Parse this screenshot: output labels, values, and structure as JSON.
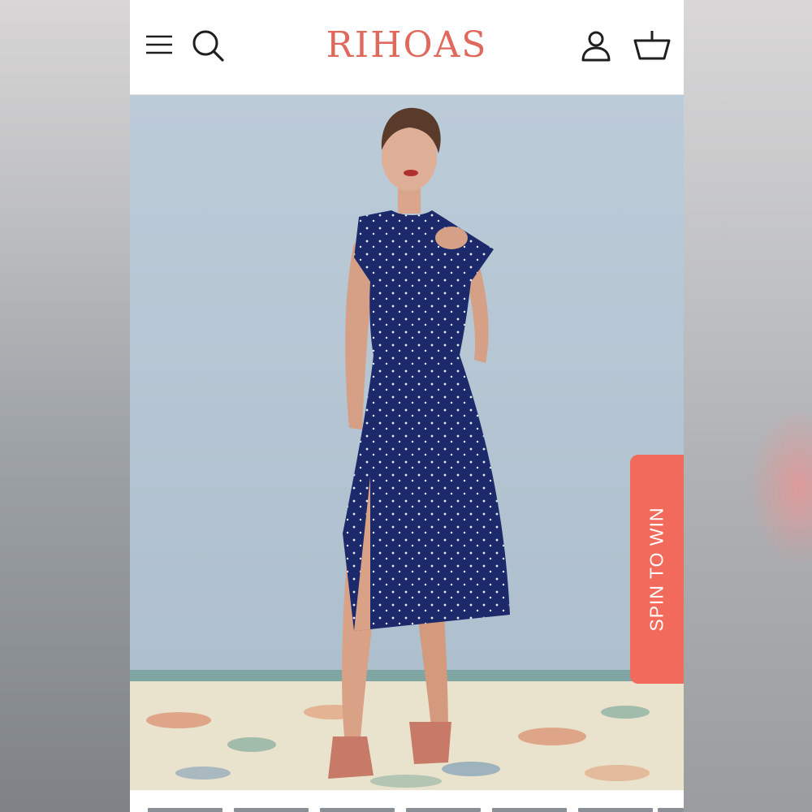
{
  "header": {
    "logo": "RIHOAS",
    "brand_color": "#e0695d",
    "icons": [
      "menu-icon",
      "search-icon",
      "account-icon",
      "cart-icon"
    ]
  },
  "hero": {
    "icons": [
      "product-photo"
    ]
  },
  "promo": {
    "spin_label": "SPIN TO WIN",
    "color": "#f26a5c"
  },
  "gallery": {
    "thumbnail_count": 7
  }
}
